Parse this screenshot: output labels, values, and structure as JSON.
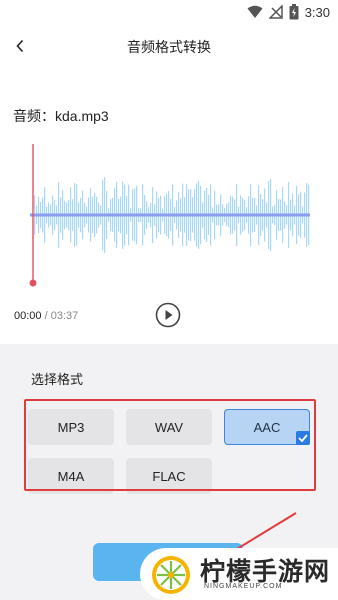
{
  "status_bar": {
    "time": "3:30"
  },
  "header": {
    "title": "音频格式转换"
  },
  "audio": {
    "file_label": "音频：kda.mp3",
    "current_time": "00:00",
    "separator": "/",
    "total_time": "03:37"
  },
  "format_panel": {
    "title": "选择格式",
    "formats": [
      "MP3",
      "WAV",
      "AAC",
      "M4A",
      "FLAC"
    ],
    "selected": "AAC"
  },
  "watermark": {
    "brand": "柠檬手游网",
    "domain": "NINGMAKEUP.COM"
  },
  "colors": {
    "wave": "#a9d8f5",
    "playhead": "#e05060",
    "highlight": "#e03c3c",
    "selected_bg": "#b8d4f5",
    "accent": "#2a7be4",
    "button": "#5ab4ef"
  }
}
